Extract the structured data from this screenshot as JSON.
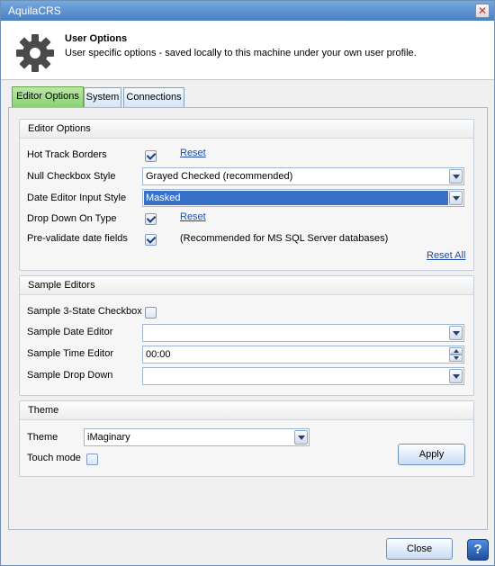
{
  "window": {
    "title": "AquilaCRS",
    "close_glyph": "✕"
  },
  "header": {
    "title": "User Options",
    "subtitle": "User specific options - saved locally to this machine under your own user profile."
  },
  "tabs": [
    {
      "label": "Editor Options",
      "active": true
    },
    {
      "label": "System",
      "active": false
    },
    {
      "label": "Connections",
      "active": false
    }
  ],
  "editor_options": {
    "title": "Editor Options",
    "hot_track_borders": {
      "label": "Hot Track Borders",
      "checked": true,
      "reset": "Reset"
    },
    "null_checkbox_style": {
      "label": "Null Checkbox Style",
      "value": "Grayed Checked (recommended)"
    },
    "date_editor_input_style": {
      "label": "Date Editor Input Style",
      "value": "Masked"
    },
    "drop_down_on_type": {
      "label": "Drop Down On Type",
      "checked": true,
      "reset": "Reset"
    },
    "pre_validate": {
      "label": "Pre-validate date fields",
      "checked": true,
      "note": "(Recommended for MS SQL Server databases)"
    },
    "reset_all": "Reset All"
  },
  "sample_editors": {
    "title": "Sample Editors",
    "three_state_label": "Sample 3-State Checkbox",
    "date_label": "Sample Date Editor",
    "date_value": "",
    "time_label": "Sample Time Editor",
    "time_value": "00:00",
    "dropdown_label": "Sample Drop Down",
    "dropdown_value": ""
  },
  "theme": {
    "title": "Theme",
    "theme_label": "Theme",
    "theme_value": "iMaginary",
    "touch_label": "Touch mode",
    "apply": "Apply"
  },
  "footer": {
    "close": "Close",
    "help_glyph": "?"
  },
  "icons": [
    "gear-icon",
    "close-icon",
    "chevron-down-icon",
    "help-icon"
  ]
}
